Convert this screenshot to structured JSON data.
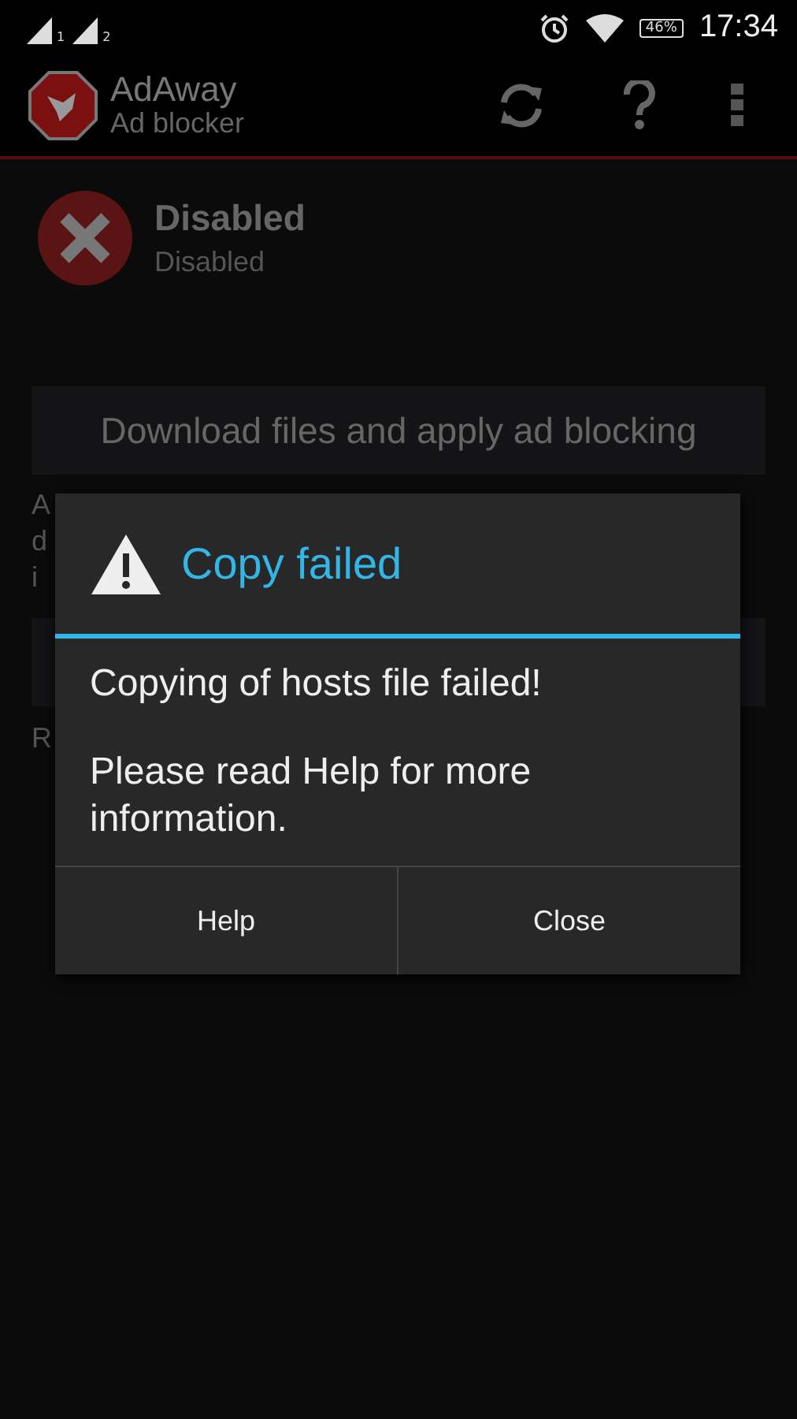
{
  "status_bar": {
    "sim_labels": [
      "1",
      "2"
    ],
    "battery": "46%",
    "time": "17:34"
  },
  "action_bar": {
    "title": "AdAway",
    "subtitle": "Ad blocker"
  },
  "status": {
    "title": "Disabled",
    "subtitle": "Disabled"
  },
  "main_button": {
    "label": "Download files and apply ad blocking"
  },
  "description_lines": [
    "A",
    "d",
    "i"
  ],
  "footer_text": "R",
  "dialog": {
    "title": "Copy failed",
    "messages": [
      "Copying of hosts file failed!",
      "Please read Help for more information."
    ],
    "buttons": [
      "Help",
      "Close"
    ]
  }
}
